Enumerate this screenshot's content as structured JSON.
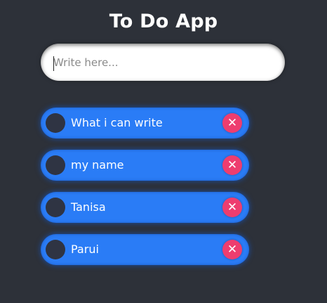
{
  "app": {
    "title": "To Do App"
  },
  "input": {
    "placeholder": "Write here...",
    "value": ""
  },
  "todos": [
    {
      "text": "What i can write",
      "done": false
    },
    {
      "text": "my name",
      "done": false
    },
    {
      "text": "Tanisa",
      "done": false
    },
    {
      "text": "Parui",
      "done": false
    }
  ],
  "icons": {
    "delete": "close-icon",
    "check": "circle-checkbox-icon"
  },
  "colors": {
    "background": "#2d3139",
    "item": "#2a7cf6",
    "delete": "#ee3d6f",
    "checkbox": "#2f3443"
  }
}
